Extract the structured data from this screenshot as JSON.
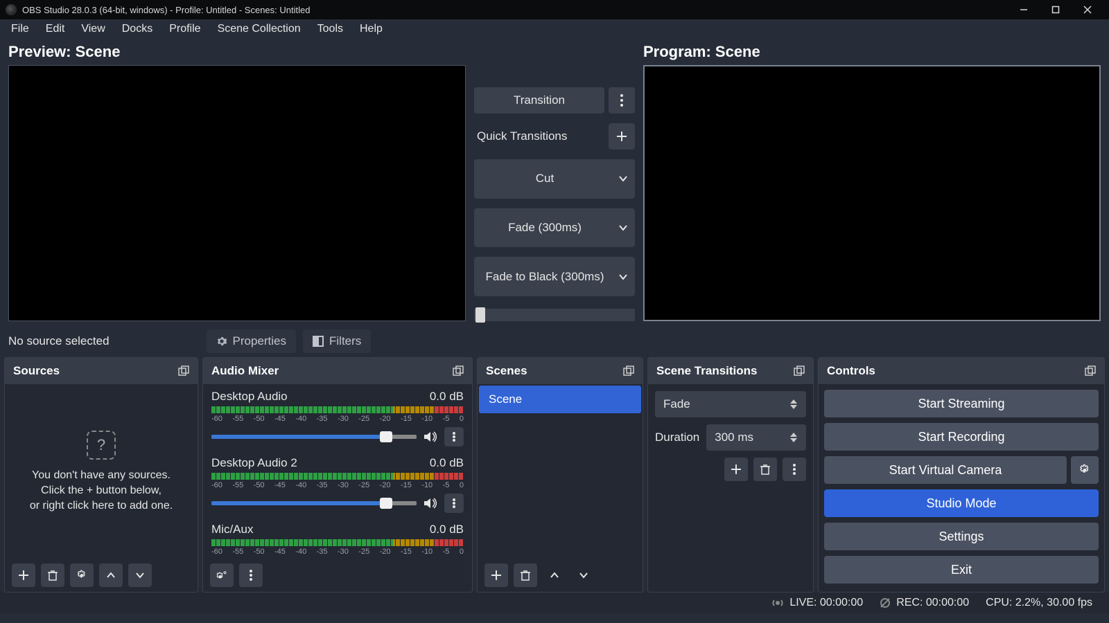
{
  "titlebar": {
    "title": "OBS Studio 28.0.3 (64-bit, windows) - Profile: Untitled - Scenes: Untitled"
  },
  "menubar": [
    "File",
    "Edit",
    "View",
    "Docks",
    "Profile",
    "Scene Collection",
    "Tools",
    "Help"
  ],
  "preview_label": "Preview: Scene",
  "program_label": "Program: Scene",
  "center": {
    "transition_btn": "Transition",
    "quick_label": "Quick Transitions",
    "quick_items": [
      "Cut",
      "Fade (300ms)",
      "Fade to Black (300ms)"
    ]
  },
  "toolbar": {
    "no_source": "No source selected",
    "properties": "Properties",
    "filters": "Filters"
  },
  "sources": {
    "title": "Sources",
    "empty1": "You don't have any sources.",
    "empty2": "Click the + button below,",
    "empty3": "or right click here to add one."
  },
  "mixer": {
    "title": "Audio Mixer",
    "ticks": [
      "-60",
      "-55",
      "-50",
      "-45",
      "-40",
      "-35",
      "-30",
      "-25",
      "-20",
      "-15",
      "-10",
      "-5",
      "0"
    ],
    "channels": [
      {
        "name": "Desktop Audio",
        "level": "0.0 dB"
      },
      {
        "name": "Desktop Audio 2",
        "level": "0.0 dB"
      },
      {
        "name": "Mic/Aux",
        "level": "0.0 dB"
      }
    ]
  },
  "scenes": {
    "title": "Scenes",
    "items": [
      "Scene"
    ]
  },
  "transitions": {
    "title": "Scene Transitions",
    "selected": "Fade",
    "duration_label": "Duration",
    "duration_value": "300 ms"
  },
  "controls": {
    "title": "Controls",
    "buttons": {
      "stream": "Start Streaming",
      "record": "Start Recording",
      "vcam": "Start Virtual Camera",
      "studio": "Studio Mode",
      "settings": "Settings",
      "exit": "Exit"
    }
  },
  "status": {
    "live": "LIVE: 00:00:00",
    "rec": "REC: 00:00:00",
    "cpu": "CPU: 2.2%, 30.00 fps"
  }
}
